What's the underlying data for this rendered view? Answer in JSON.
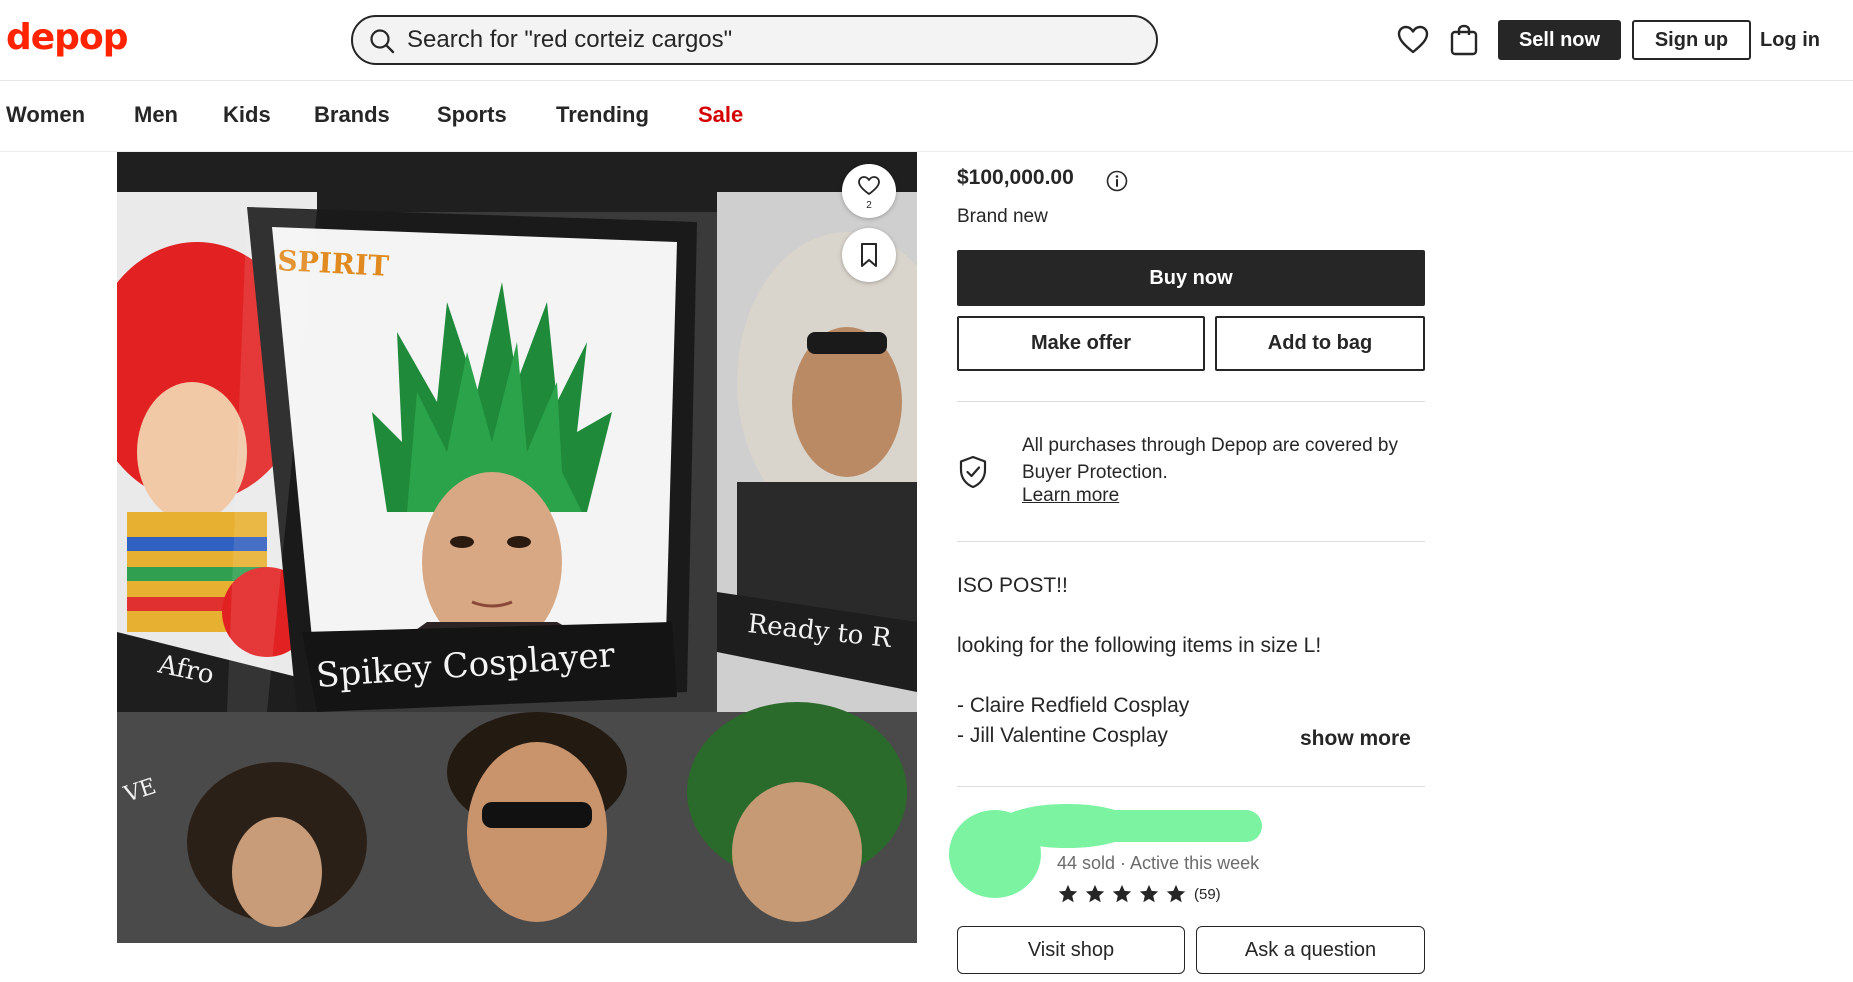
{
  "header": {
    "logo": "depop",
    "search_placeholder": "Search for \"red corteiz cargos\"",
    "sell_label": "Sell now",
    "signup_label": "Sign up",
    "login_label": "Log in"
  },
  "categories": [
    "Women",
    "Men",
    "Kids",
    "Brands",
    "Sports",
    "Trending",
    "Sale"
  ],
  "image": {
    "like_count": "2",
    "packaging_brand": "SPIRIT",
    "packaging_title": "Spikey Cosplayer",
    "left_package_label": "Afro",
    "right_package_label": "Ready to R",
    "bottom_left_fragment": "VE"
  },
  "product": {
    "price": "$100,000.00",
    "condition": "Brand new",
    "buy_label": "Buy now",
    "offer_label": "Make offer",
    "bag_label": "Add to bag",
    "protection_text": "All purchases through Depop are covered by Buyer Protection.",
    "learn_more": "Learn more"
  },
  "description": {
    "lines": [
      "ISO POST!!",
      "looking for the following items in size L!",
      "- Claire Redfield Cosplay",
      "- Jill Valentine Cosplay"
    ],
    "show_more": "show more"
  },
  "seller": {
    "stats": "44 sold · Active this week",
    "rating": 5,
    "reviews": "(59)",
    "visit_label": "Visit shop",
    "ask_label": "Ask a question"
  },
  "colors": {
    "brand_red": "#ff2300",
    "sale_red": "#d50000",
    "dark": "#262626",
    "redaction_green": "#7cf3a0"
  }
}
